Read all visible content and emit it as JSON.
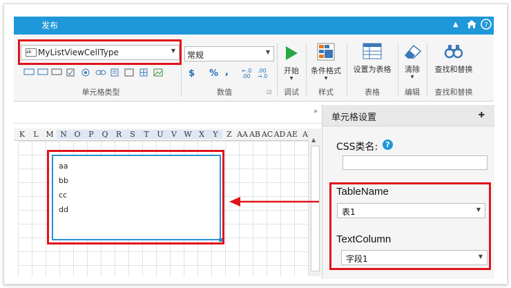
{
  "titlebar": {
    "tab": "发布"
  },
  "ribbon": {
    "celltype_combo": "MyListViewCellType",
    "celltype_group": "单元格类型",
    "number_combo": "常规",
    "number_group": "数值",
    "currency": "$",
    "percent": "%",
    "comma": ",",
    "start_label": "开始",
    "debug_group": "调试",
    "cond_format_label": "条件格式",
    "style_group": "样式",
    "set_table_label": "设置为表格",
    "table_group": "表格",
    "clear_label": "清除",
    "edit_group": "编辑",
    "find_replace_label": "查找和替换",
    "find_group": "查找和替换"
  },
  "columns": [
    "K",
    "L",
    "M",
    "N",
    "O",
    "P",
    "Q",
    "R",
    "S",
    "T",
    "U",
    "V",
    "W",
    "X",
    "Y",
    "Z",
    "AA",
    "AB",
    "AC",
    "AD",
    "AE",
    "A"
  ],
  "listview": {
    "items": [
      "aa",
      "bb",
      "cc",
      "dd"
    ]
  },
  "panel": {
    "title": "单元格设置",
    "css_label": "CSS类名:",
    "help": "?",
    "table_name_label": "TableName",
    "table_name_value": "表1",
    "text_column_label": "TextColumn",
    "text_column_value": "字段1"
  },
  "colors": {
    "accent": "#1e98d8",
    "highlight": "#e0131a"
  }
}
